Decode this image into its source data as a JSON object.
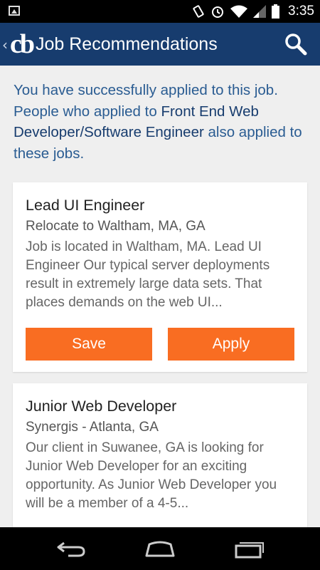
{
  "status_bar": {
    "time": "3:35"
  },
  "app_bar": {
    "logo": "cb",
    "title": "Job Recommendations"
  },
  "intro": {
    "text_before": "You have successfully applied to this job. People who applied to ",
    "job_link": "Front End Web Developer/Software Engineer",
    "text_after": " also applied to these jobs."
  },
  "jobs": [
    {
      "title": "Lead UI Engineer",
      "location": "Relocate to Waltham, MA, GA",
      "description": "Job is located in Waltham, MA. Lead UI Engineer Our typical server deployments result in extremely large data sets. That places demands on the web UI...",
      "save_label": "Save",
      "apply_label": "Apply"
    },
    {
      "title": "Junior Web Developer",
      "location": "Synergis - Atlanta, GA",
      "description": "Our client in Suwanee, GA is looking for Junior Web Developer for an exciting opportunity. As Junior Web Developer you will be a member of a 4-5..."
    }
  ],
  "colors": {
    "app_bar": "#173c6e",
    "accent_button": "#f96d22",
    "intro_text": "#2a5c92"
  }
}
